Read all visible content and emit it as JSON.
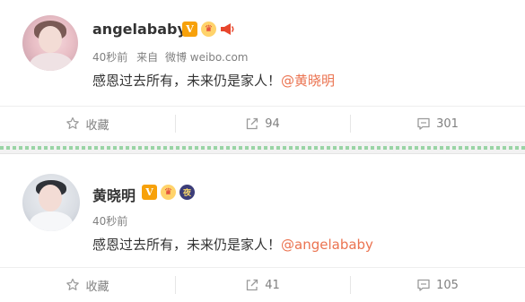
{
  "posts": [
    {
      "username": "angelababy",
      "badges": [
        "verified-v-badge",
        "crown-badge",
        "megaphone-badge"
      ],
      "time": "40秒前",
      "source_prefix": "来自",
      "source": "微博 weibo.com",
      "text": "感恩过去所有，未来仍是家人！",
      "mention": "@黄晓明",
      "actions": {
        "favorite": "收藏",
        "repost": "94",
        "comment": "301"
      }
    },
    {
      "username": "黄晓明",
      "badges": [
        "verified-v-badge",
        "crown-badge",
        "night-badge"
      ],
      "time": "40秒前",
      "text": "感恩过去所有，未来仍是家人！",
      "mention": "@angelababy",
      "actions": {
        "favorite": "收藏",
        "repost": "41",
        "comment": "105"
      }
    }
  ],
  "badge_glyphs": {
    "v": "V",
    "crown": "♛",
    "horn": "📢",
    "night": "夜"
  },
  "colors": {
    "mention": "#eb7350",
    "meta": "#808080",
    "badge_v": "#f7a10a",
    "divider_dots": "#9ad4a5"
  }
}
